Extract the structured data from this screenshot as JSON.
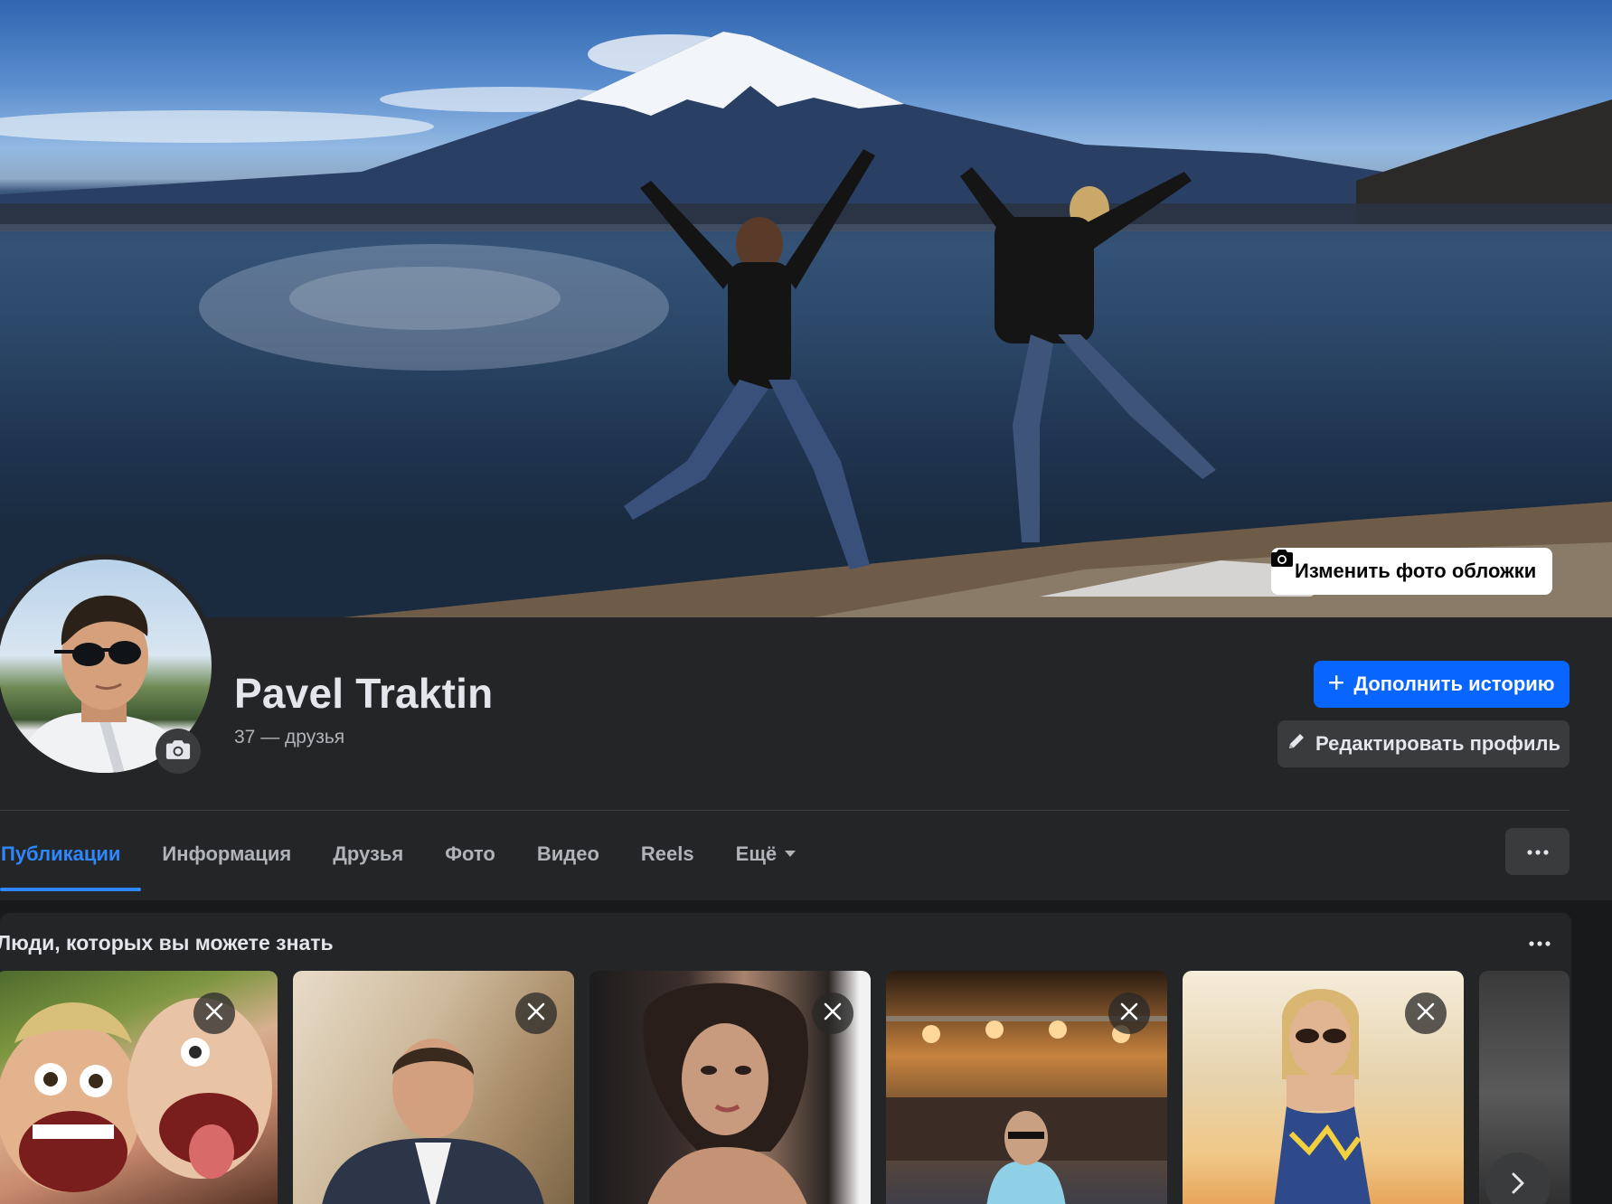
{
  "cover": {
    "edit_cover_label": "Изменить фото обложки",
    "camera_icon": "camera-icon"
  },
  "profile": {
    "name": "Pavel Traktin",
    "friends_text": "37 — друзья",
    "avatar_camera_icon": "camera-icon"
  },
  "actions": {
    "add_story_label": "Дополнить историю",
    "add_story_icon": "plus-icon",
    "edit_profile_label": "Редактировать профиль",
    "edit_profile_icon": "pencil-icon"
  },
  "tabs": [
    {
      "label": "Публикации",
      "active": true
    },
    {
      "label": "Информация",
      "active": false
    },
    {
      "label": "Друзья",
      "active": false
    },
    {
      "label": "Фото",
      "active": false
    },
    {
      "label": "Видео",
      "active": false
    },
    {
      "label": "Reels",
      "active": false
    },
    {
      "label": "Ещё",
      "active": false,
      "dropdown": true
    }
  ],
  "people_you_may_know": {
    "title": "Люди, которых вы можете знать",
    "cards": 6
  },
  "colors": {
    "accent": "#2d88ff",
    "primary_button": "#0866ff",
    "surface": "#242526",
    "background": "#18191a",
    "secondary_button": "#3a3b3c"
  }
}
